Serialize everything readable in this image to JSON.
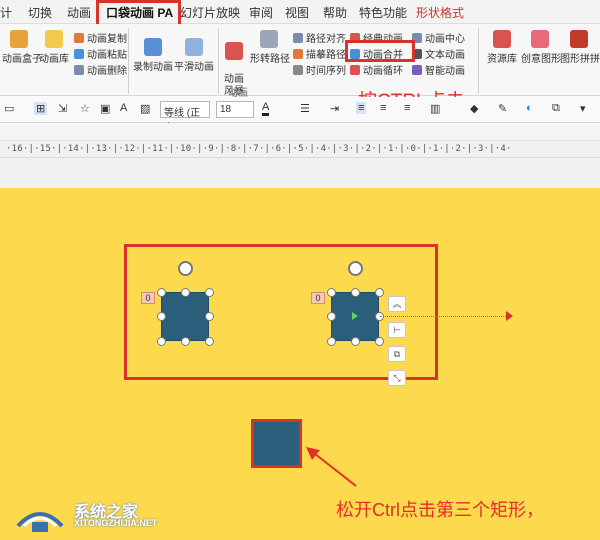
{
  "tabs": [
    {
      "label": "计"
    },
    {
      "label": "切换"
    },
    {
      "label": "动画"
    },
    {
      "label": "口袋动画 PA"
    },
    {
      "label": "幻灯片放映"
    },
    {
      "label": "审阅"
    },
    {
      "label": "视图"
    },
    {
      "label": "帮助"
    },
    {
      "label": "特色功能"
    },
    {
      "label": "形状格式"
    }
  ],
  "ribbon": {
    "anim_box": "动画盒子",
    "anim_lib": "动画库",
    "anim_copy": "动画复制",
    "anim_paste": "动画粘贴",
    "anim_delete": "动画删除",
    "record_anim": "录制动画",
    "smooth_anim": "平滑动画",
    "anim_storm": "动画\n风暴",
    "shape_path": "形转路径",
    "path_align": "路径对齐",
    "draw_path": "描摹路径",
    "timeline": "时间序列",
    "classic_anim": "经典动画",
    "anim_merge": "动画合并",
    "anim_loop": "动画循环",
    "anim_center": "动画中心",
    "text_anim": "文本动画",
    "smart_anim": "智能动画",
    "resource_lib": "资源库",
    "creative_shape": "创意图形",
    "shape_puzzle": "图形拼拼",
    "group_anim": "动画"
  },
  "callouts": {
    "top": "按CTRL点击",
    "bottom": "松开Ctrl点击第三个矩形，"
  },
  "formatbar": {
    "font_name": "等线 (正文",
    "font_size": "18"
  },
  "ruler": {
    "text": "·16·|·15·|·14·|·13·|·12·|·11·|·10·|·9·|·8·|·7·|·6·|·5·|·4·|·3·|·2·|·1·|·0·|·1·|·2·|·3·|·4·"
  },
  "slide": {
    "badge_left": "0",
    "badge_right": "0"
  },
  "watermark": {
    "title": "系统之家",
    "url": "XITONGZHIJIA.NET"
  },
  "colors": {
    "slide_bg": "#fdd94e",
    "shape_fill": "#2a5e7a",
    "highlight_red": "#d9322a"
  }
}
